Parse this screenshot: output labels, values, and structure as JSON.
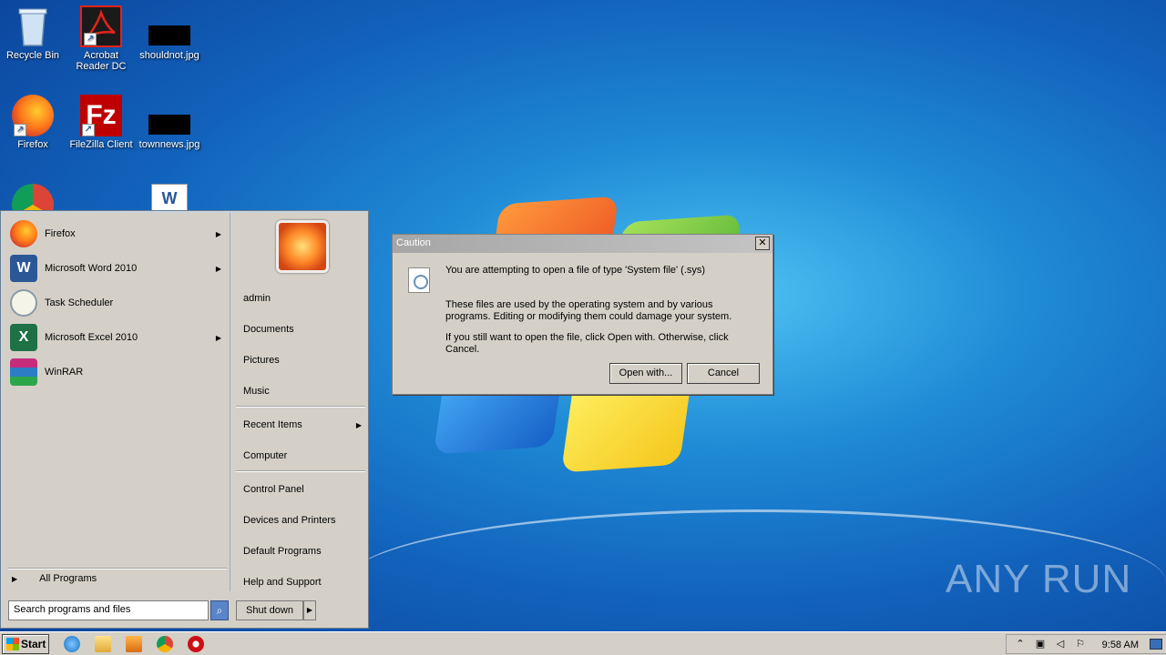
{
  "desktop": {
    "icons": [
      {
        "label": "Recycle Bin",
        "icon": "recycle-bin-icon"
      },
      {
        "label": "Acrobat Reader DC",
        "icon": "acrobat-icon"
      },
      {
        "label": "shouldnot.jpg",
        "icon": "image-file-icon"
      },
      {
        "label": "Firefox",
        "icon": "firefox-icon"
      },
      {
        "label": "FileZilla Client",
        "icon": "filezilla-icon"
      },
      {
        "label": "townnews.jpg",
        "icon": "image-file-icon"
      }
    ],
    "watermark": "ANY RUN"
  },
  "start_menu": {
    "programs": [
      {
        "label": "Firefox",
        "has_submenu": true,
        "color": "#e8651c"
      },
      {
        "label": "Microsoft Word 2010",
        "has_submenu": true,
        "color": "#2b5797"
      },
      {
        "label": "Task Scheduler",
        "has_submenu": false,
        "color": "#d0d8e0"
      },
      {
        "label": "Microsoft Excel 2010",
        "has_submenu": true,
        "color": "#1e7145"
      },
      {
        "label": "WinRAR",
        "has_submenu": false,
        "color": "#8b2a6b"
      }
    ],
    "all_programs": "All Programs",
    "search_placeholder": "Search programs and files",
    "shutdown": "Shut down",
    "right": {
      "user": "admin",
      "documents": "Documents",
      "pictures": "Pictures",
      "music": "Music",
      "recent_items": "Recent Items",
      "computer": "Computer",
      "control_panel": "Control Panel",
      "devices_printers": "Devices and Printers",
      "default_programs": "Default Programs",
      "help_support": "Help and Support"
    }
  },
  "dialog": {
    "title": "Caution",
    "close": "✕",
    "line1": "You are attempting to open a file of type 'System file' (.sys)",
    "line2": "These files are used by the operating system and by various programs. Editing or modifying them could damage your system.",
    "line3": "If you still want to open the file, click Open with. Otherwise, click Cancel.",
    "open_with": "Open with...",
    "cancel": "Cancel"
  },
  "taskbar": {
    "start": "Start",
    "clock": "9:58 AM"
  }
}
